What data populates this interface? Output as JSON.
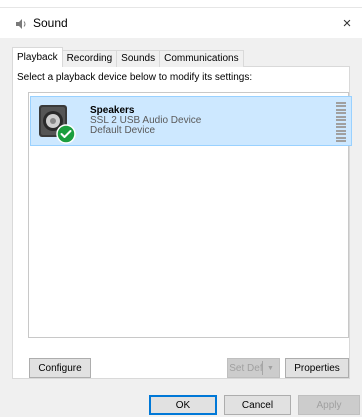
{
  "window": {
    "title": "Sound",
    "close_glyph": "×"
  },
  "tabs": [
    {
      "label": "Playback",
      "active": true
    },
    {
      "label": "Recording",
      "active": false
    },
    {
      "label": "Sounds",
      "active": false
    },
    {
      "label": "Communications",
      "active": false
    }
  ],
  "panel": {
    "instruction": "Select a playback device below to modify its settings:"
  },
  "device": {
    "name": "Speakers",
    "line2": "SSL 2   USB Audio Device",
    "line3": "Default Device",
    "icon": "speaker-icon",
    "status_icon": "default-check-icon"
  },
  "buttons": {
    "configure": "Configure",
    "set_default": "Set Default",
    "set_default_arrow": "▼",
    "properties": "Properties",
    "ok": "OK",
    "cancel": "Cancel",
    "apply": "Apply"
  },
  "colors": {
    "selection_bg": "#cde8ff",
    "selection_border": "#99d1ff",
    "default_check": "#1b9e3e",
    "primary_border": "#0078d7"
  }
}
